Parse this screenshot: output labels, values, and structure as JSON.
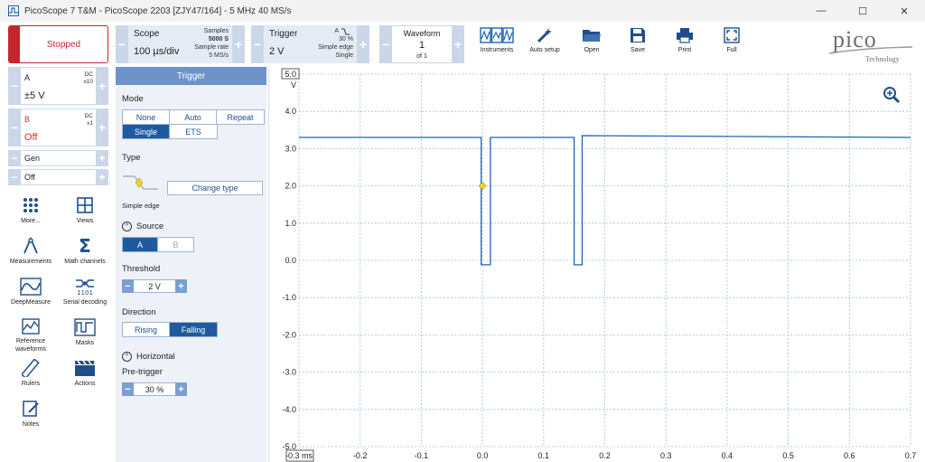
{
  "window": {
    "title": "PicoScope 7 T&M  - PicoScope 2203 [ZJY47/164] - 5 MHz 40 MS/s",
    "controls": [
      "—",
      "☐",
      "✕"
    ]
  },
  "toolbar": {
    "run_state": "Stopped",
    "scope": {
      "label": "Scope",
      "timebase": "100 µs/div",
      "samples_label": "Samples",
      "samples_value": "5000 S",
      "rate_label": "Sample rate",
      "rate_value": "5 MS/s"
    },
    "trigger": {
      "label": "Trigger",
      "level": "2 V",
      "channel": "A",
      "pretrigger": "30 %",
      "type": "Simple edge",
      "mode": "Single"
    },
    "waveform": {
      "label": "Waveform",
      "current": "1",
      "of": "of 1"
    },
    "buttons": {
      "instruments": "Instruments",
      "auto_setup": "Auto setup",
      "open": "Open",
      "save": "Save",
      "print": "Print",
      "full": "Full"
    },
    "logo_word": "pico",
    "logo_sub": "Technology"
  },
  "channels": {
    "a": {
      "name": "A",
      "coupling": "DC",
      "probe": "x10",
      "range": "±5 V",
      "color": "#1f63b4"
    },
    "b": {
      "name": "B",
      "coupling": "DC",
      "probe": "x1",
      "range": "Off",
      "color": "#d32f2f"
    },
    "gen": {
      "name": "Gen",
      "state": "Off"
    }
  },
  "tools": [
    {
      "label": "More...",
      "icon": "dots-grid-icon"
    },
    {
      "label": "Views",
      "icon": "views-grid-icon"
    },
    {
      "label": "Measurements",
      "icon": "measurements-icon"
    },
    {
      "label": "Math channels",
      "icon": "sigma-icon"
    },
    {
      "label": "DeepMeasure",
      "icon": "deepmeasure-icon"
    },
    {
      "label": "Serial decoding",
      "icon": "serial-decoding-icon"
    },
    {
      "label": "Reference waveforms",
      "icon": "reference-waveform-icon"
    },
    {
      "label": "Masks",
      "icon": "masks-icon"
    },
    {
      "label": "Rulers",
      "icon": "ruler-icon"
    },
    {
      "label": "Actions",
      "icon": "clapper-icon"
    },
    {
      "label": "Notes",
      "icon": "notes-icon"
    }
  ],
  "trigger_panel": {
    "header": "Trigger",
    "mode_label": "Mode",
    "modes": [
      "None",
      "Auto",
      "Repeat",
      "Single",
      "ETS"
    ],
    "mode_selected": "Single",
    "type_label": "Type",
    "type_name": "Simple edge",
    "change_type": "Change type",
    "source_label": "Source",
    "sources": [
      "A",
      "B"
    ],
    "source_selected": "A",
    "threshold_label": "Threshold",
    "threshold_value": "2 V",
    "direction_label": "Direction",
    "directions": [
      "Rising",
      "Falling"
    ],
    "direction_selected": "Falling",
    "horizontal_label": "Horizontal",
    "pretrigger_label": "Pre-trigger",
    "pretrigger_value": "30 %"
  },
  "chart_data": {
    "type": "line",
    "xlabel": "ms",
    "ylabel": "V",
    "xlim": [
      -0.3,
      0.7
    ],
    "ylim": [
      -5.0,
      5.0
    ],
    "x_ticks": [
      "-0.3 ms",
      "-0.2",
      "-0.1",
      "0.0",
      "0.1",
      "0.2",
      "0.3",
      "0.4",
      "0.5",
      "0.6",
      "0.7"
    ],
    "y_ticks": [
      "5.0",
      "4.0",
      "3.0",
      "2.0",
      "1.0",
      "0.0",
      "-1.0",
      "-2.0",
      "-3.0",
      "-4.0",
      "-5.0"
    ],
    "y_unit": "V",
    "grid": true,
    "trigger_marker": {
      "x": 0.0,
      "y": 2.0
    },
    "series": [
      {
        "name": "A",
        "color": "#1f63b4",
        "x": [
          -0.3,
          -0.002,
          -0.002,
          0.013,
          0.013,
          0.15,
          0.15,
          0.163,
          0.163,
          0.7
        ],
        "y": [
          3.3,
          3.3,
          -0.12,
          -0.12,
          3.3,
          3.3,
          -0.12,
          -0.12,
          3.35,
          3.3
        ]
      }
    ]
  }
}
